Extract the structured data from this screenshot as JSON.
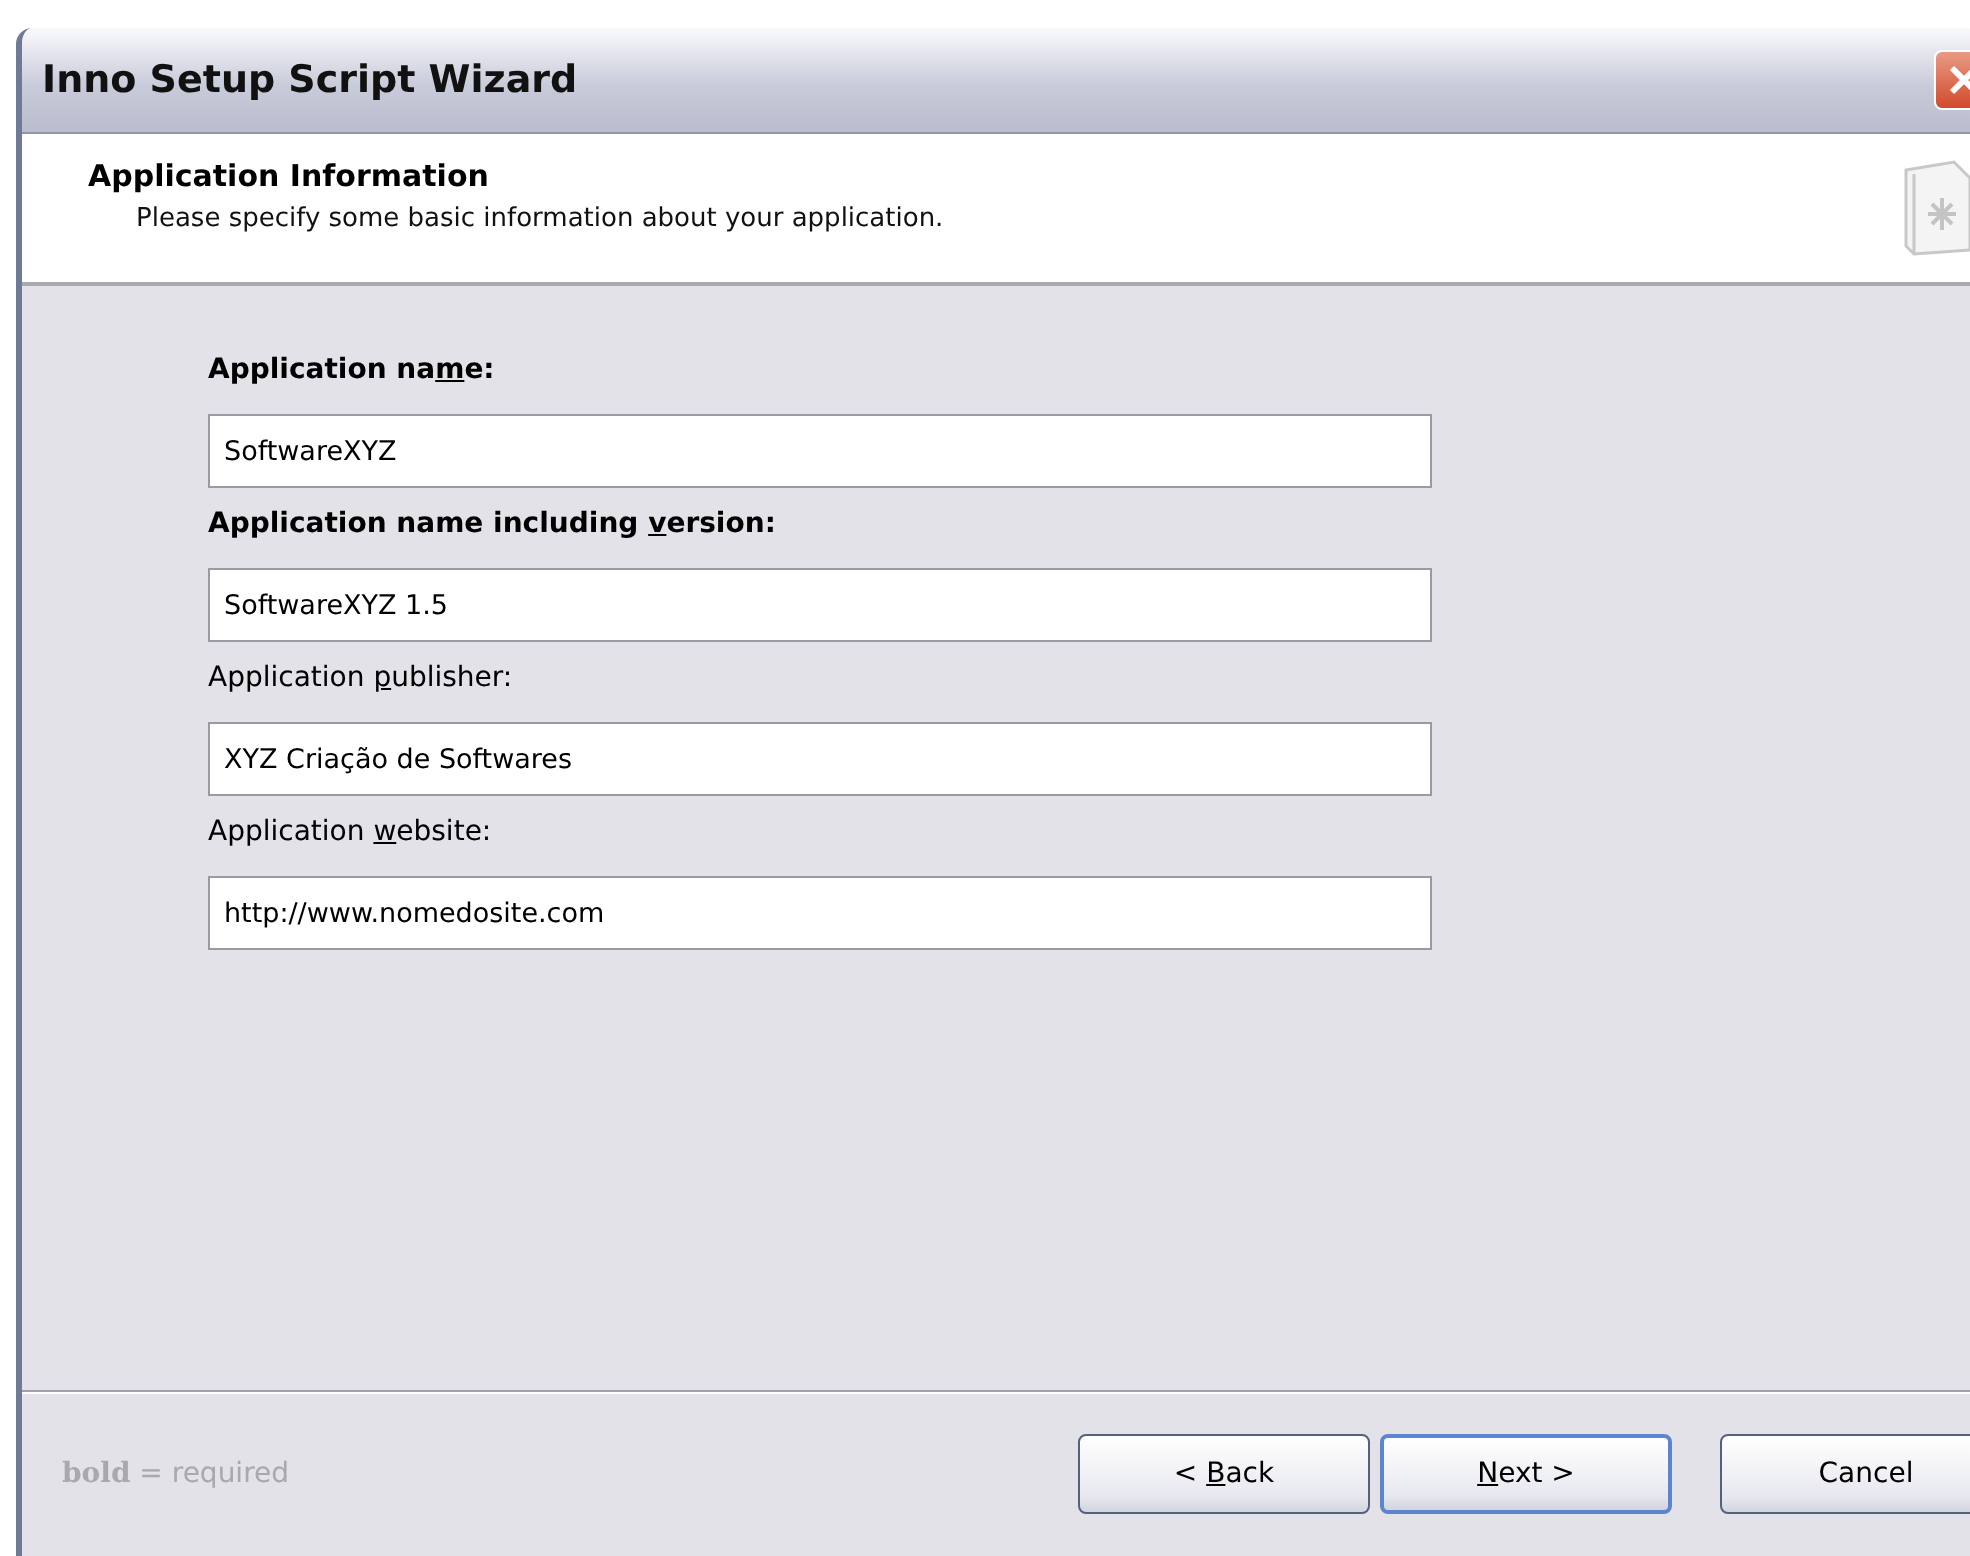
{
  "window": {
    "title": "Inno Setup Script Wizard"
  },
  "header": {
    "title": "Application Information",
    "subtitle": "Please specify some basic information about your application."
  },
  "fields": [
    {
      "label": {
        "pre": "Application na",
        "key": "m",
        "post": "e:"
      },
      "required": true,
      "value": "SoftwareXYZ"
    },
    {
      "label": {
        "pre": "Application name including ",
        "key": "v",
        "post": "ersion:"
      },
      "required": true,
      "value": "SoftwareXYZ 1.5"
    },
    {
      "label": {
        "pre": "Application ",
        "key": "p",
        "post": "ublisher:"
      },
      "required": false,
      "value": "XYZ Criação de Softwares"
    },
    {
      "label": {
        "pre": "Application ",
        "key": "w",
        "post": "ebsite:"
      },
      "required": false,
      "value": "http://www.nomedosite.com"
    }
  ],
  "footer": {
    "legend": "**bold** = required"
  },
  "buttons": [
    {
      "label": {
        "pre": "< ",
        "key": "B",
        "post": "ack"
      },
      "default": false
    },
    {
      "label": {
        "key": "N",
        "post": "ext >"
      },
      "default": true
    },
    {
      "label": {
        "pre": "Cancel"
      },
      "default": false
    }
  ]
}
